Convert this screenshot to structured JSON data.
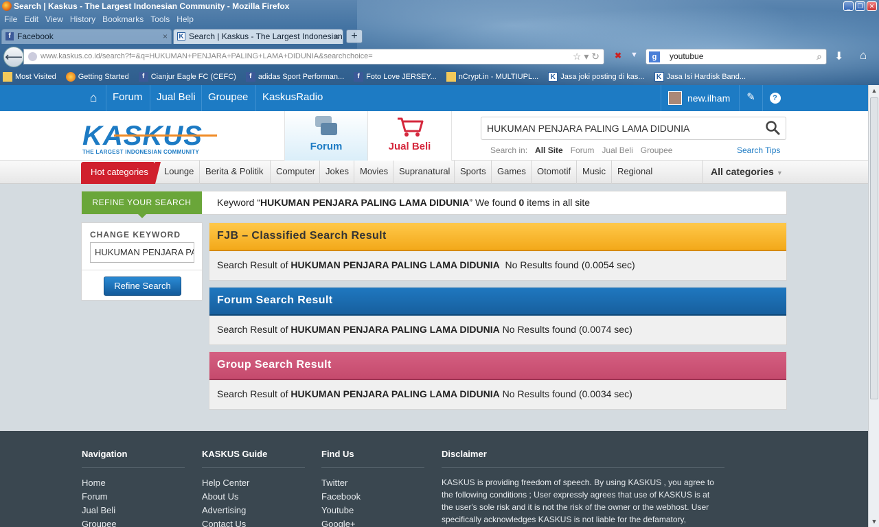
{
  "browser": {
    "window_title": "Search | Kaskus - The Largest Indonesian Community - Mozilla Firefox",
    "menu": [
      "File",
      "Edit",
      "View",
      "History",
      "Bookmarks",
      "Tools",
      "Help"
    ],
    "tabs": [
      {
        "label": "Facebook",
        "favicon": "facebook-icon"
      },
      {
        "label": "Search | Kaskus - The Largest Indonesian ...",
        "favicon": "kaskus-icon"
      }
    ],
    "url": "www.kaskus.co.id/search?f=&q=HUKUMAN+PENJARA+PALING+LAMA+DIDUNIA&searchchoice=",
    "search_value": "youtubue",
    "bookmarks": [
      {
        "label": "Most Visited",
        "icon": "folder-icon"
      },
      {
        "label": "Getting Started",
        "icon": "firefox-icon"
      },
      {
        "label": "Cianjur Eagle FC (CEFC)",
        "icon": "facebook-icon"
      },
      {
        "label": "adidas Sport Performan...",
        "icon": "facebook-icon"
      },
      {
        "label": "Foto Love JERSEY...",
        "icon": "facebook-icon"
      },
      {
        "label": "nCrypt.in - MULTIUPL...",
        "icon": "folder-icon"
      },
      {
        "label": "Jasa joki posting di kas...",
        "icon": "kaskus-icon"
      },
      {
        "label": "Jasa Isi Hardisk Band...",
        "icon": "kaskus-icon"
      }
    ]
  },
  "kaskus": {
    "topnav": [
      "Forum",
      "Jual Beli",
      "Groupee",
      "KaskusRadio"
    ],
    "username": "new.ilham",
    "logo_text": "KASKUS",
    "logo_tagline": "THE LARGEST INDONESIAN COMMUNITY",
    "tab_forum": "Forum",
    "tab_jualbeli": "Jual Beli",
    "search_query": "HUKUMAN PENJARA PALING LAMA DIDUNIA",
    "search_in_label": "Search in:",
    "search_in_options": [
      "All Site",
      "Forum",
      "Jual Beli",
      "Groupee"
    ],
    "search_tips": "Search Tips",
    "hot_categories": "Hot categories",
    "categories": [
      "Lounge",
      "Berita & Politik",
      "Computer",
      "Jokes",
      "Movies",
      "Supranatural",
      "Sports",
      "Games",
      "Otomotif",
      "Music",
      "Regional"
    ],
    "all_categories": "All categories",
    "refine_label": "REFINE YOUR SEARCH",
    "refine": {
      "pre": "Keyword “",
      "keyword": "HUKUMAN PENJARA PALING LAMA DIDUNIA",
      "mid": "” We found ",
      "count": "0",
      "post": " items in all site"
    },
    "change_keyword_label": "CHANGE KEYWORD",
    "change_keyword_value": "HUKUMAN PENJARA PALING LAMA DIDUNIA",
    "refine_button": "Refine Search",
    "results": {
      "prefix": "Search Result of ",
      "fjb": {
        "title": "FJB – Classified Search Result",
        "keyword": "HUKUMAN PENJARA PALING LAMA DIDUNIA",
        "status": "  No Results found (0.0054 sec)",
        "color": "#f3a91a"
      },
      "forum": {
        "title": "Forum Search Result",
        "keyword": "HUKUMAN PENJARA PALING LAMA DIDUNIA",
        "status": " No Results found (0.0074 sec)",
        "color": "#1f78c0"
      },
      "group": {
        "title": "Group Search Result",
        "keyword": "HUKUMAN PENJARA PALING LAMA DIDUNIA",
        "status": " No Results found (0.0034 sec)",
        "color": "#c54a6d"
      }
    },
    "footer": {
      "navigation": {
        "title": "Navigation",
        "links": [
          "Home",
          "Forum",
          "Jual Beli",
          "Groupee"
        ]
      },
      "guide": {
        "title": "KASKUS Guide",
        "links": [
          "Help Center",
          "About Us",
          "Advertising",
          "Contact Us"
        ]
      },
      "findus": {
        "title": "Find Us",
        "links": [
          "Twitter",
          "Facebook",
          "Youtube",
          "Google+"
        ]
      },
      "disclaimer": {
        "title": "Disclaimer",
        "text": "KASKUS is providing freedom of speech. By using KASKUS , you agree to the following conditions ; User expressly agrees that use of KASKUS is at the user's sole risk and it is not the risk of the owner or the webhost. User specifically acknowledges KASKUS is not liable for the defamatory,"
      }
    }
  }
}
